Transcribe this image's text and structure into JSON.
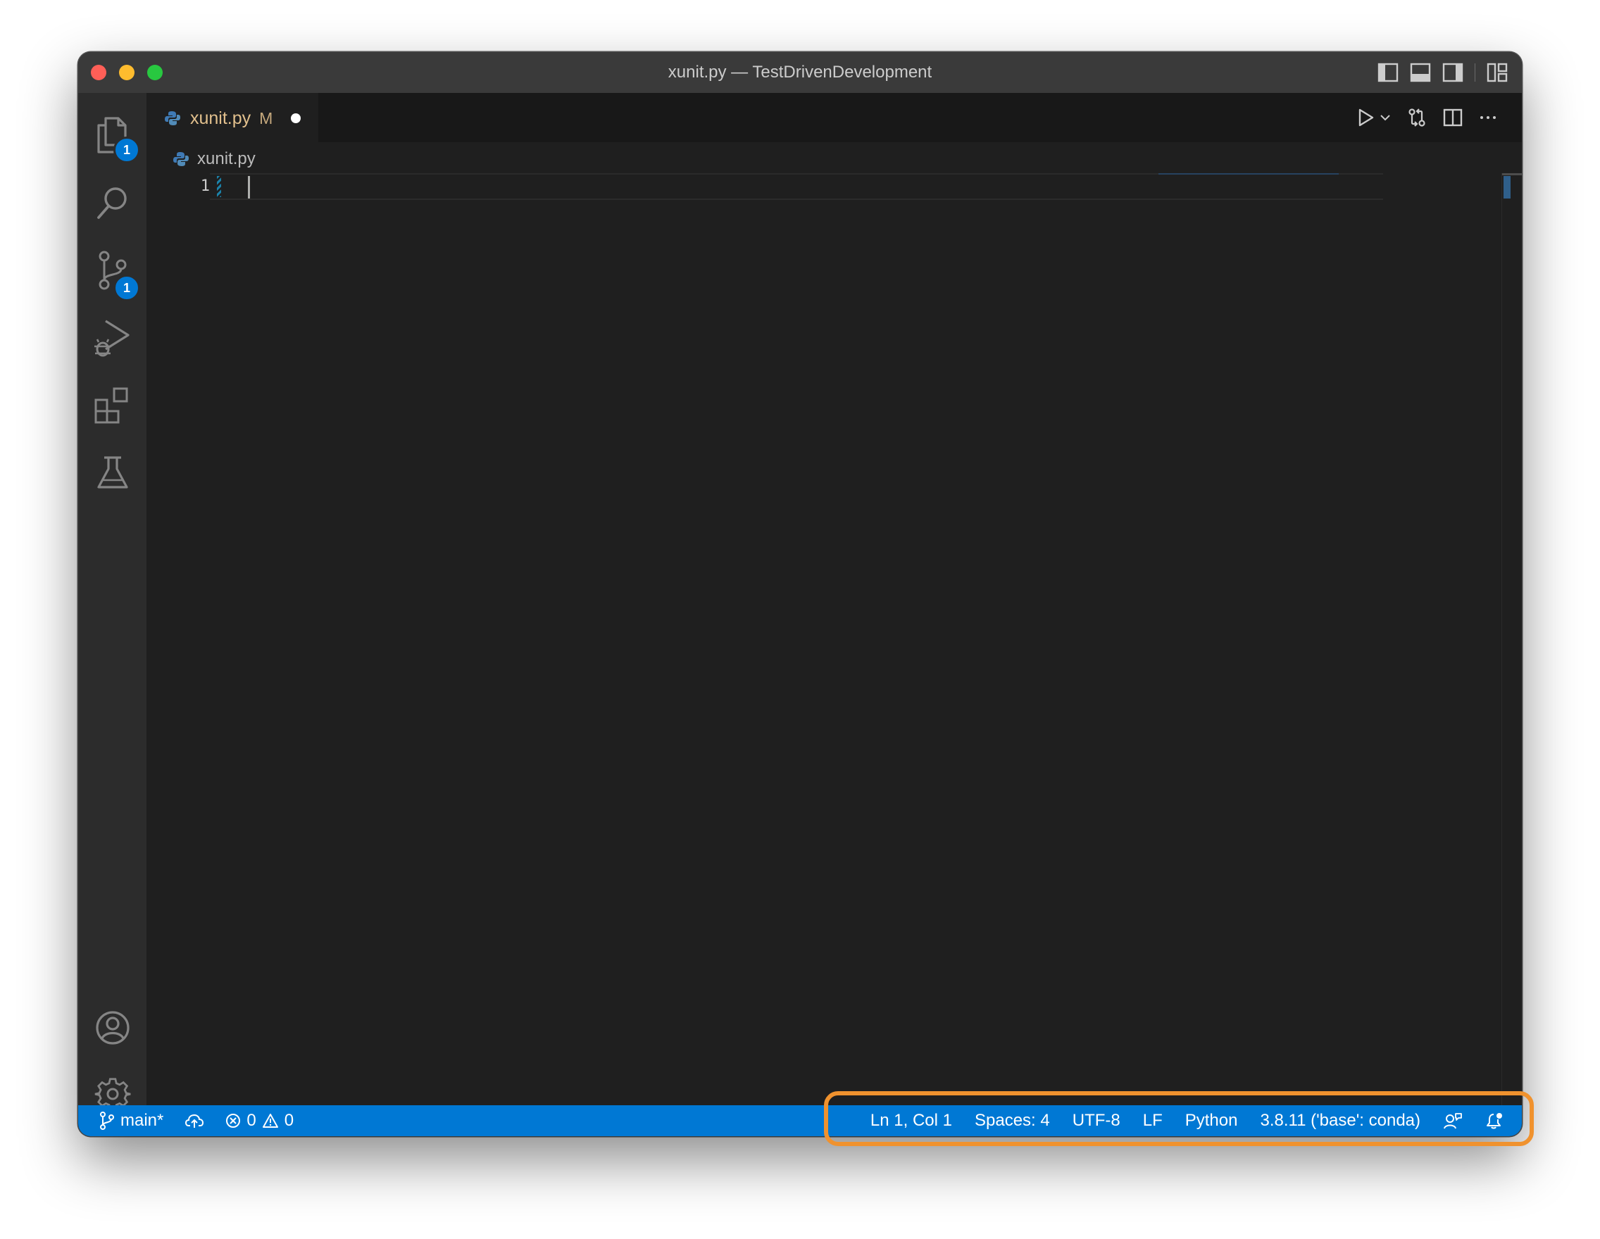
{
  "window": {
    "title": "xunit.py — TestDrivenDevelopment"
  },
  "activity_bar": {
    "explorer_badge": "1",
    "scm_badge": "1"
  },
  "editor": {
    "tab": {
      "filename": "xunit.py",
      "modified_marker": "M"
    },
    "breadcrumb": "xunit.py",
    "lines": [
      {
        "number": "1",
        "text": ""
      }
    ]
  },
  "status_bar": {
    "branch": "main*",
    "errors": "0",
    "warnings": "0",
    "cursor_position": "Ln 1, Col 1",
    "indentation": "Spaces: 4",
    "encoding": "UTF-8",
    "eol": "LF",
    "language": "Python",
    "interpreter": "3.8.11 ('base': conda)"
  },
  "colors": {
    "status_bar_bg": "#0078d4",
    "highlight_outline": "#f0922e",
    "tab_modified_text": "#e2c08d",
    "badge_bg": "#0078d4"
  }
}
